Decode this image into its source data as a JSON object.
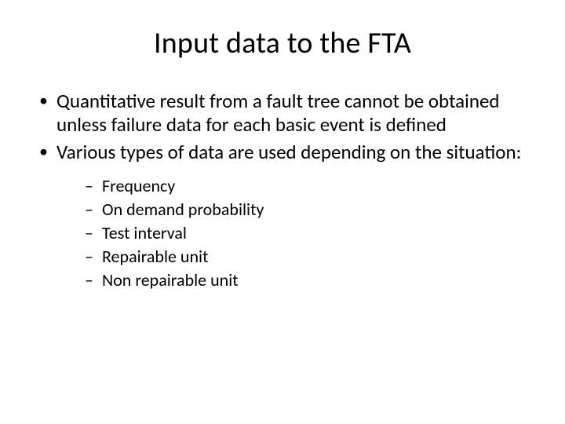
{
  "title": "Input data to the FTA",
  "bullets": [
    "Quantitative result from a fault tree cannot be obtained unless failure data for each basic event is defined",
    "Various types of data are used depending on the situation:"
  ],
  "subbullets": [
    "Frequency",
    "On demand probability",
    "Test interval",
    "Repairable unit",
    "Non repairable unit"
  ]
}
